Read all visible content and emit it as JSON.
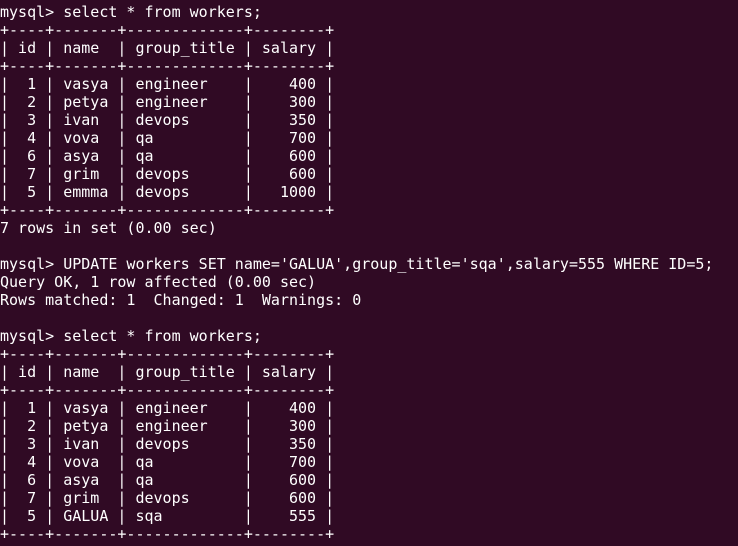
{
  "prompt": "mysql> ",
  "commands": [
    "select * from workers;",
    "UPDATE workers SET name='GALUA',group_title='sqa',salary=555 WHERE ID=5;",
    "select * from workers;"
  ],
  "table_border": "+----+-------+-------------+--------+",
  "table_header": "| id | name  | group_title | salary |",
  "before_rows": [
    "|  1 | vasya | engineer    |    400 |",
    "|  2 | petya | engineer    |    300 |",
    "|  3 | ivan  | devops      |    350 |",
    "|  4 | vova  | qa          |    700 |",
    "|  6 | asya  | qa          |    600 |",
    "|  7 | grim  | devops      |    600 |",
    "|  5 | emmma | devops      |   1000 |"
  ],
  "rows_in_set": "7 rows in set (0.00 sec)",
  "update_result": [
    "Query OK, 1 row affected (0.00 sec)",
    "Rows matched: 1  Changed: 1  Warnings: 0"
  ],
  "after_rows": [
    "|  1 | vasya | engineer    |    400 |",
    "|  2 | petya | engineer    |    300 |",
    "|  3 | ivan  | devops      |    350 |",
    "|  4 | vova  | qa          |    700 |",
    "|  6 | asya  | qa          |    600 |",
    "|  7 | grim  | devops      |    600 |",
    "|  5 | GALUA | sqa         |    555 |"
  ],
  "colors": {
    "background": "#300a24",
    "text": "#ffffff"
  }
}
